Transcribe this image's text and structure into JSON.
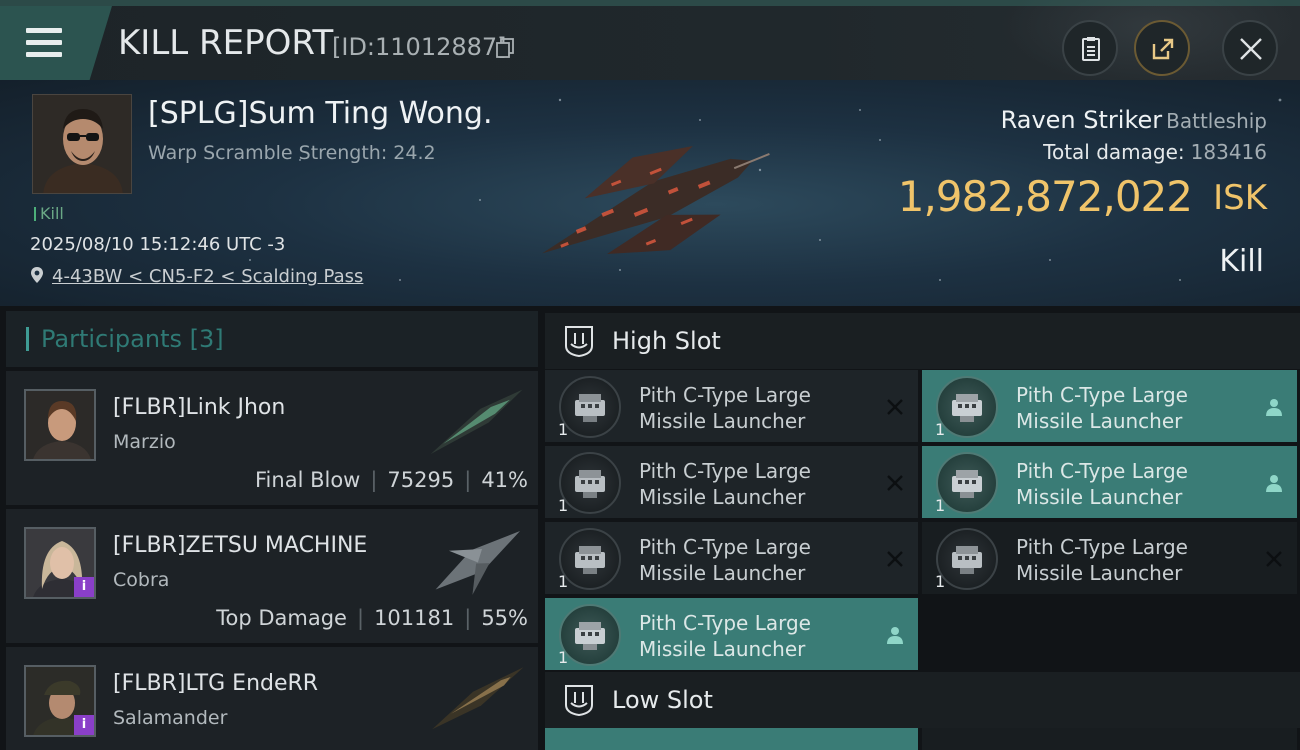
{
  "header": {
    "title": "KILL REPORT",
    "report_id": "[ID:11012887]"
  },
  "victim": {
    "name": "[SPLG]Sum Ting Wong.",
    "warp_scramble": "Warp Scramble Strength: 24.2",
    "tag": "Kill",
    "datetime": "2025/08/10 15:12:46 UTC -3",
    "location": "4-43BW < CN5-F2 < Scalding Pass",
    "ship_name": "Raven Striker",
    "ship_class": "Battleship",
    "total_damage_label": "Total damage:",
    "total_damage": "183416",
    "isk_value": "1,982,872,022",
    "isk_unit": "ISK",
    "result": "Kill"
  },
  "participants": {
    "label": "Participants [3]",
    "rows": [
      {
        "name": "[FLBR]Link Jhon",
        "ship": "Marzio",
        "stat_label": "Final Blow",
        "damage": "75295",
        "percent": "41%",
        "badge": ""
      },
      {
        "name": "[FLBR]ZETSU MACHINE",
        "ship": "Cobra",
        "stat_label": "Top Damage",
        "damage": "101181",
        "percent": "55%",
        "badge": "i"
      },
      {
        "name": "[FLBR]LTG EndeRR",
        "ship": "Salamander",
        "stat_label": "",
        "damage": "",
        "percent": "",
        "badge": "i"
      }
    ]
  },
  "slots": {
    "high_label": "High Slot",
    "low_label": "Low Slot",
    "high_modules": [
      {
        "line1": "Pith C-Type Large",
        "line2": "Missile Launcher",
        "qty": "1",
        "status": "destroyed-icon"
      },
      {
        "line1": "Pith C-Type Large",
        "line2": "Missile Launcher",
        "qty": "1",
        "status": "dropped-icon"
      },
      {
        "line1": "Pith C-Type Large",
        "line2": "Missile Launcher",
        "qty": "1",
        "status": "destroyed-icon"
      },
      {
        "line1": "Pith C-Type Large",
        "line2": "Missile Launcher",
        "qty": "1",
        "status": "dropped-icon"
      },
      {
        "line1": "Pith C-Type Large",
        "line2": "Missile Launcher",
        "qty": "1",
        "status": "destroyed-icon"
      },
      {
        "line1": "Pith C-Type Large",
        "line2": "Missile Launcher",
        "qty": "1",
        "status": "destroyed-icon"
      },
      {
        "line1": "Pith C-Type Large",
        "line2": "Missile Launcher",
        "qty": "1",
        "status": "dropped-icon"
      }
    ]
  },
  "colors": {
    "accent_teal": "#3a7c76",
    "isk_gold": "#f0c46a",
    "badge_purple": "#8a3fc8"
  }
}
